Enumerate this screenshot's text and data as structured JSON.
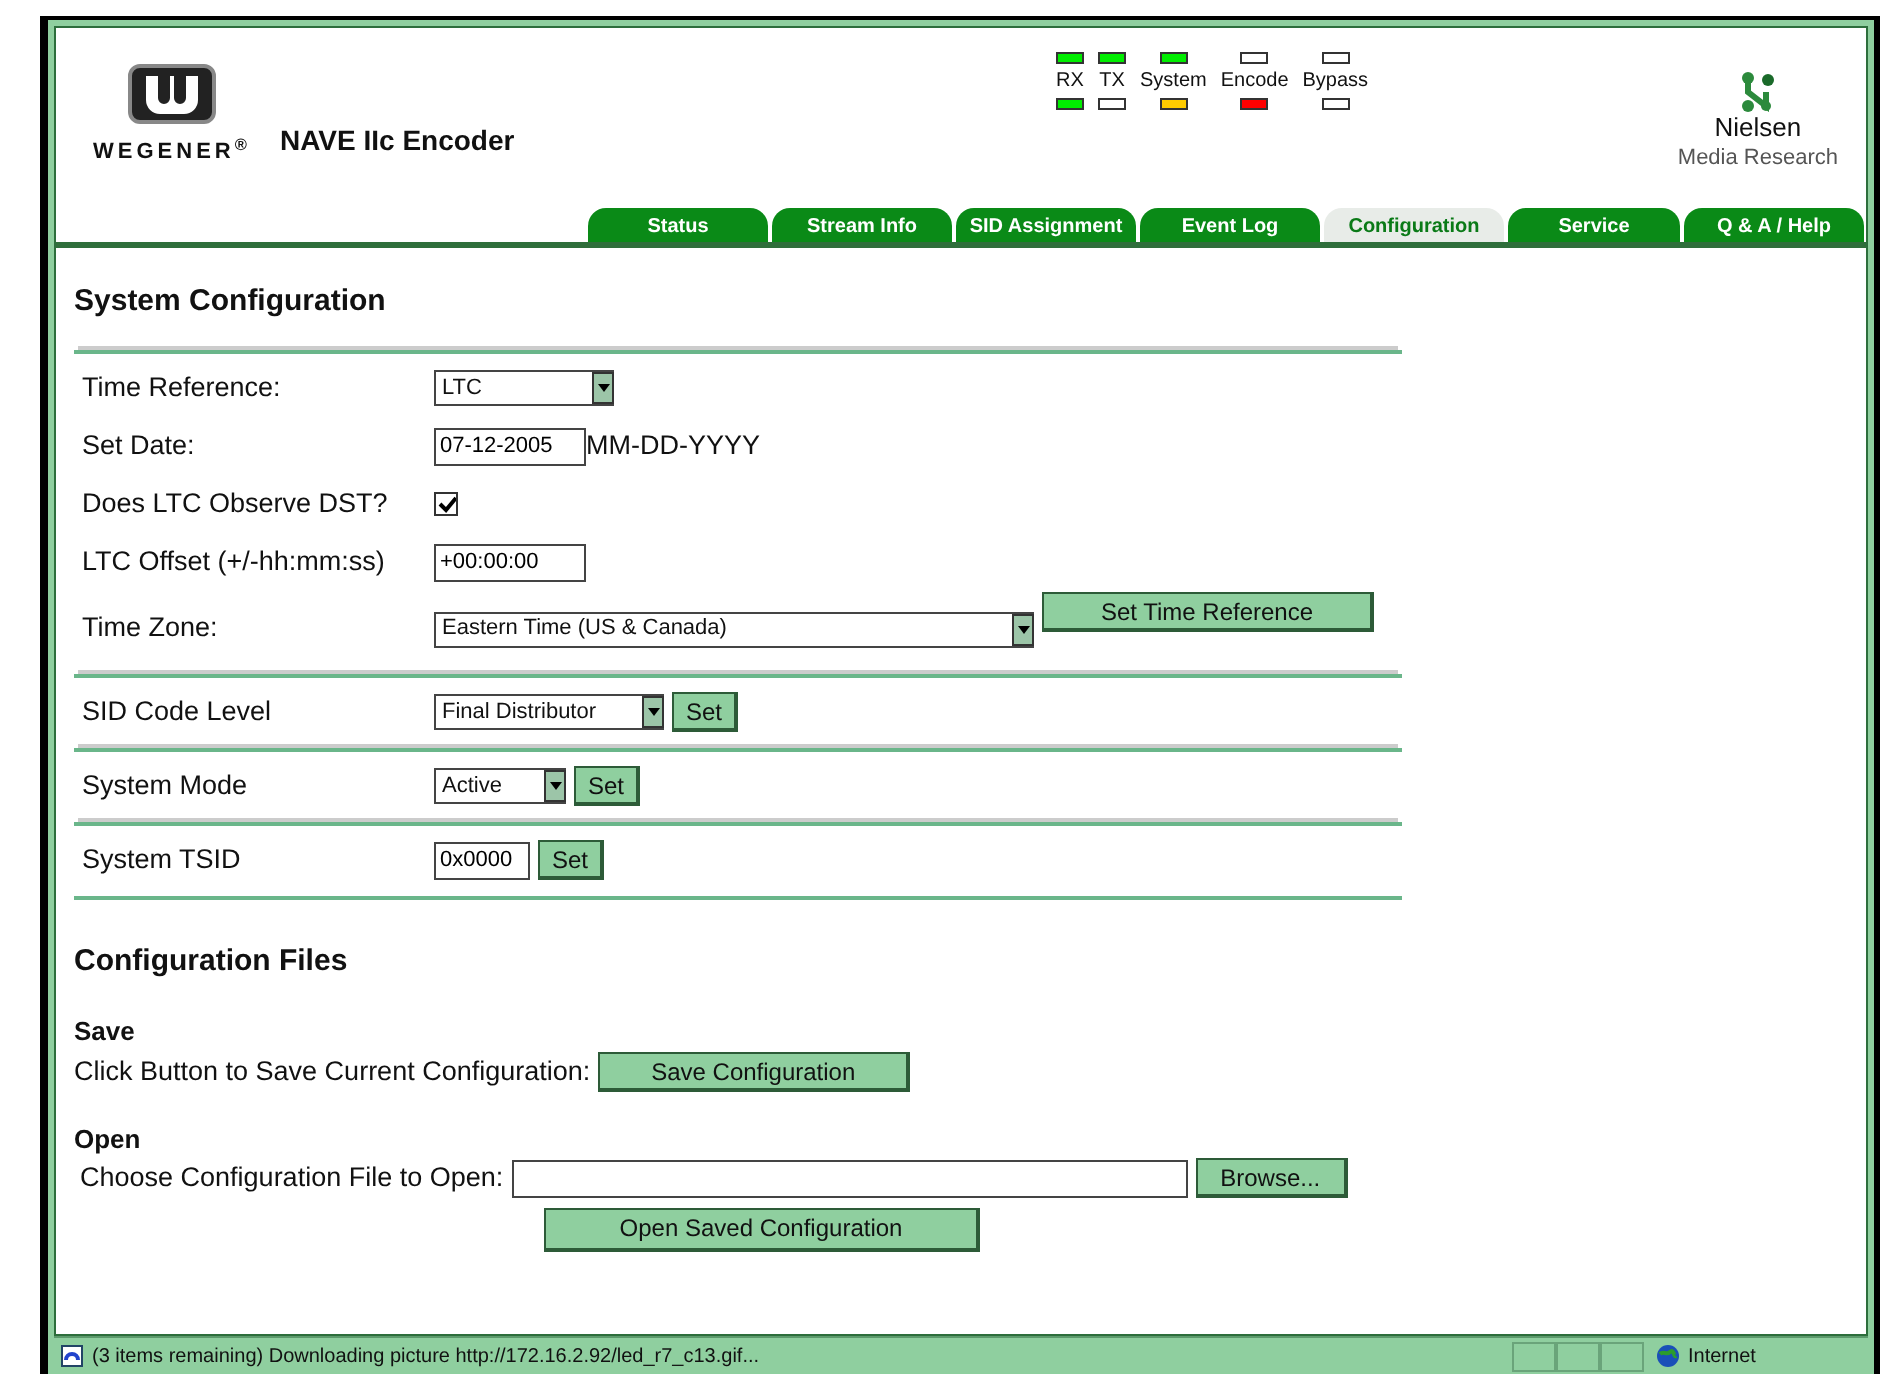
{
  "header": {
    "brand": "WEGENER$^{®}$",
    "title": "NAVE IIc Encoder",
    "partner": "Nielsen",
    "partner_sub": "Media Research"
  },
  "leds": [
    {
      "label": "RX",
      "top": {
        "lit": true,
        "color": "#00ee00"
      },
      "bottom": {
        "lit": true,
        "color": "#00ee00"
      }
    },
    {
      "label": "TX",
      "top": {
        "lit": true,
        "color": "#00ee00"
      },
      "bottom": {
        "lit": false
      }
    },
    {
      "label": "System",
      "top": {
        "lit": true,
        "color": "#00ee00"
      },
      "bottom": {
        "lit": true,
        "color": "#ffcc00"
      }
    },
    {
      "label": "Encode",
      "top": {
        "lit": false
      },
      "bottom": {
        "lit": true,
        "color": "#ff0000"
      }
    },
    {
      "label": "Bypass",
      "top": {
        "lit": false
      },
      "bottom": {
        "lit": false
      }
    }
  ],
  "tabs": [
    {
      "label": "Status",
      "selected": false
    },
    {
      "label": "Stream Info",
      "selected": false
    },
    {
      "label": "SID Assignment",
      "selected": false
    },
    {
      "label": "Event Log",
      "selected": false
    },
    {
      "label": "Configuration",
      "selected": true
    },
    {
      "label": "Service",
      "selected": false
    },
    {
      "label": "Q & A / Help",
      "selected": false
    }
  ],
  "system_configuration": {
    "heading": "System Configuration",
    "groups": [
      [
        {
          "label": "Time Reference:",
          "kind": "select",
          "value": "LTC"
        },
        {
          "label": "Set Date:",
          "kind": "text",
          "value": "07-12-2005",
          "hint": "MM-DD-YYYY"
        },
        {
          "label": "Does LTC Observe DST?",
          "kind": "checkbox",
          "checked": true
        },
        {
          "label": "LTC Offset (+/-hh:mm:ss)",
          "kind": "text",
          "value": "+00:00:00"
        },
        {
          "label": "Time Zone:",
          "kind": "select",
          "value": "Eastern Time (US & Canada)",
          "button": "Set Time Reference"
        }
      ],
      [
        {
          "label": "SID Code Level",
          "kind": "select",
          "value": "Final Distributor",
          "button": "Set"
        }
      ],
      [
        {
          "label": "System Mode",
          "kind": "select",
          "value": "Active",
          "button": "Set"
        }
      ],
      [
        {
          "label": "System TSID",
          "kind": "text",
          "value": "0x0000",
          "button": "Set"
        }
      ]
    ]
  },
  "configuration_files": {
    "heading": "Configuration Files",
    "save": {
      "heading": "Save",
      "label": "Click Button to Save Current Configuration:",
      "button": "Save Configuration"
    },
    "open": {
      "heading": "Open",
      "label": "Choose Configuration File to Open:",
      "browse_button": "Browse...",
      "button": "Open Saved Configuration"
    }
  },
  "status_bar": {
    "message": "(3 items remaining) Downloading picture http://172.16.2.92/led_r7_c13.gif...",
    "zone": "Internet"
  }
}
